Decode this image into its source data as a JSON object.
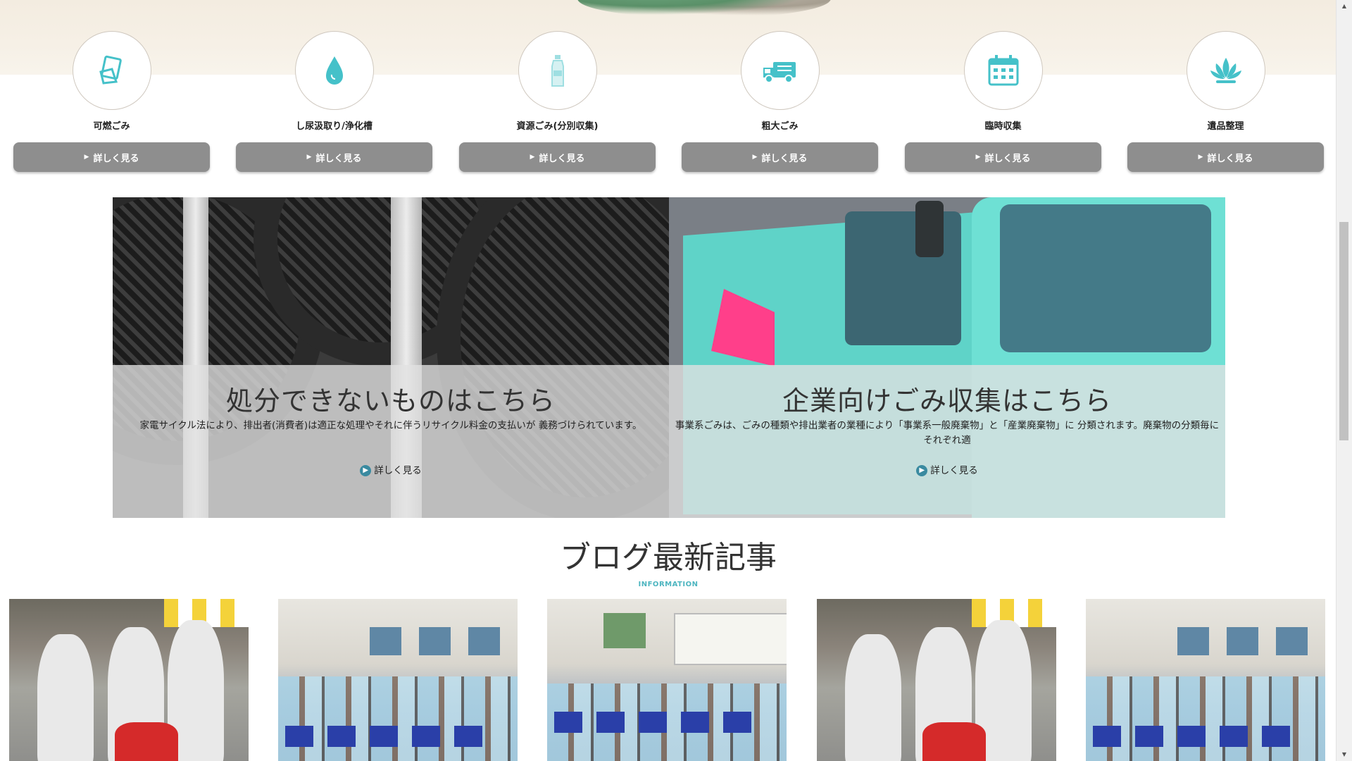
{
  "categories": [
    {
      "label": "可燃ごみ",
      "button": "詳しく見る",
      "icon": "paper-trash-icon"
    },
    {
      "label": "し尿汲取り/浄化槽",
      "button": "詳しく見る",
      "icon": "water-drop-icon"
    },
    {
      "label": "資源ごみ(分別収集)",
      "button": "詳しく見る",
      "icon": "bottle-icon"
    },
    {
      "label": "粗大ごみ",
      "button": "詳しく見る",
      "icon": "truck-icon"
    },
    {
      "label": "臨時収集",
      "button": "詳しく見る",
      "icon": "calendar-icon"
    },
    {
      "label": "遺品整理",
      "button": "詳しく見る",
      "icon": "lotus-icon"
    }
  ],
  "promos": {
    "left": {
      "title": "処分できないものはこちら",
      "text": "家電サイクル法により、排出者(消費者)は適正な処理やそれに伴うリサイクル料金の支払いが 義務づけられています。",
      "more": "詳しく見る"
    },
    "right": {
      "title": "企業向けごみ収集はこちら",
      "text": "事業系ごみは、ごみの種類や排出業者の業種により「事業系一般廃棄物」と「産業廃棄物」に 分類されます。廃棄物の分類毎にそれぞれ適",
      "more": "詳しく見る"
    }
  },
  "blog": {
    "title": "ブログ最新記事",
    "subtitle": "INFORMATION"
  },
  "colors": {
    "button_gray": "#8e8e8e",
    "accent_teal": "#4db5c0",
    "icon_teal": "#45c1c9"
  }
}
